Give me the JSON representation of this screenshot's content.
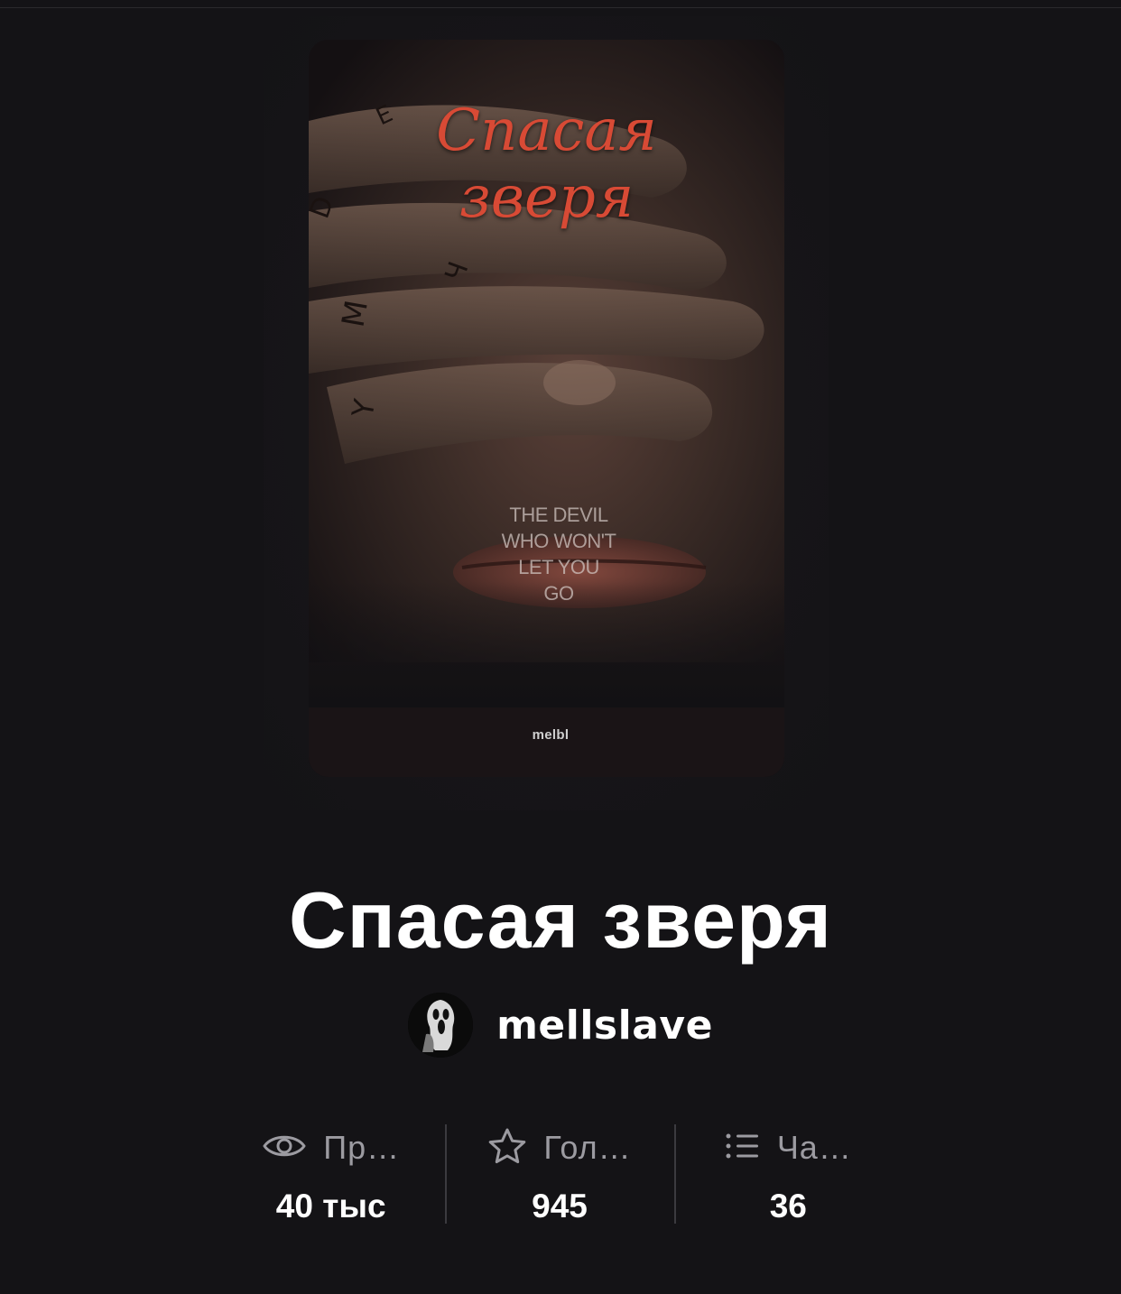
{
  "cover": {
    "title_line1": "Спасая",
    "title_line2": "зверя",
    "tagline": [
      "THE DEVIL",
      "WHO WON'T",
      "LET YOU",
      "GO"
    ],
    "brand": "melbl"
  },
  "book": {
    "title": "Спасая зверя",
    "author": "mellslave"
  },
  "stats": [
    {
      "icon": "eye-icon",
      "label": "Пр…",
      "value": "40 тыс"
    },
    {
      "icon": "star-icon",
      "label": "Гол…",
      "value": "945"
    },
    {
      "icon": "list-icon",
      "label": "Ча…",
      "value": "36"
    }
  ],
  "colors": {
    "background": "#141316",
    "title": "#ffffff",
    "muted": "#9c9ba1",
    "divider": "#3b3a3f",
    "cover_title": "#d84a35"
  }
}
